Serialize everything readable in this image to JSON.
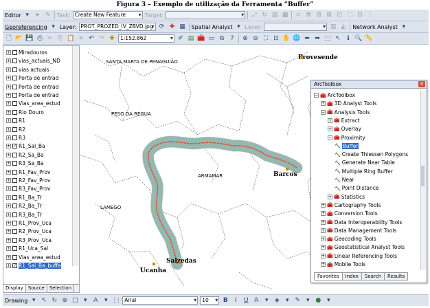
{
  "caption": "Figura 3 – Exemplo de utilização da Ferramenta “Buffer”",
  "toolbar1": {
    "editor_label": "Editor",
    "task_label": "Task:",
    "task_value": "Create New Feature",
    "target_label": "Target:",
    "target_value": ""
  },
  "toolbar2": {
    "georef_label": "Georeferencing",
    "layer_label": "Layer:",
    "layer_value": "PROT_PROZED_IV_ZBVD.jpg",
    "spatial_label": "Spatial Analyst",
    "layer2_label": "Layer:",
    "layer2_value": "",
    "network_label": "Network Analyst"
  },
  "toolbar3": {
    "scale_value": "1:152.862"
  },
  "layers": [
    {
      "name": "Miradouros",
      "checked": false
    },
    {
      "name": "vias_actuais_ND",
      "checked": false
    },
    {
      "name": "vias actuais",
      "checked": false
    },
    {
      "name": "Porta de entrad",
      "checked": false
    },
    {
      "name": "Porta de entrad",
      "checked": false
    },
    {
      "name": "Porta de entrad",
      "checked": false
    },
    {
      "name": "Vias_area_estud",
      "checked": false
    },
    {
      "name": "Rio Douro",
      "checked": false
    },
    {
      "name": "R1",
      "checked": false
    },
    {
      "name": "R2",
      "checked": false
    },
    {
      "name": "R3",
      "checked": false
    },
    {
      "name": "R1_Sal_Ba",
      "checked": true
    },
    {
      "name": "R2_Sa_Ba",
      "checked": false
    },
    {
      "name": "R3_Sa_Ba",
      "checked": false
    },
    {
      "name": "R1_Fav_Prov",
      "checked": false
    },
    {
      "name": "R2_Fav_Prov",
      "checked": false
    },
    {
      "name": "R3_Fav_Prov",
      "checked": false
    },
    {
      "name": "R1_Ba_Tr",
      "checked": false
    },
    {
      "name": "R2_Ba_Tr",
      "checked": false
    },
    {
      "name": "R3_Ba_Tr",
      "checked": false
    },
    {
      "name": "R1_Prov_Uca",
      "checked": false
    },
    {
      "name": "R2_Prov_Uca",
      "checked": false
    },
    {
      "name": "R3_Prov_Uca",
      "checked": false
    },
    {
      "name": "R1_Uca_Sal",
      "checked": false
    },
    {
      "name": "Vias_area_estud",
      "checked": false
    },
    {
      "name": "R1_Sal_Ba_buffe",
      "checked": true,
      "selected": true
    }
  ],
  "sidebar_tabs": [
    "Display",
    "Source",
    "Selection"
  ],
  "map": {
    "places": [
      {
        "name": "SANTA MARTA DE PENAGUIÃO",
        "style": "small"
      },
      {
        "name": "PESO DA RÉGUA",
        "style": "small"
      },
      {
        "name": "ARMAMAR",
        "style": "small"
      },
      {
        "name": "LAMEGO",
        "style": "small"
      },
      {
        "name": "Provesende",
        "style": "big"
      },
      {
        "name": "Barcos",
        "style": "big"
      },
      {
        "name": "Salzedas",
        "style": "big"
      },
      {
        "name": "Ucanha",
        "style": "big"
      }
    ],
    "buffer_color": "#b8e6dc",
    "route_color": "#e04a2f"
  },
  "arctoolbox": {
    "title": "ArcToolbox",
    "items": [
      {
        "label": "ArcToolbox",
        "level": 0,
        "type": "root"
      },
      {
        "label": "3D Analyst Tools",
        "level": 1,
        "type": "box"
      },
      {
        "label": "Analysis Tools",
        "level": 1,
        "type": "box"
      },
      {
        "label": "Extract",
        "level": 2,
        "type": "set"
      },
      {
        "label": "Overlay",
        "level": 2,
        "type": "set"
      },
      {
        "label": "Proximity",
        "level": 2,
        "type": "set"
      },
      {
        "label": "Buffer",
        "level": 3,
        "type": "tool",
        "highlight": true
      },
      {
        "label": "Create Thiessen Polygons",
        "level": 3,
        "type": "tool"
      },
      {
        "label": "Generate Near Table",
        "level": 3,
        "type": "tool"
      },
      {
        "label": "Multiple Ring Buffer",
        "level": 3,
        "type": "tool"
      },
      {
        "label": "Near",
        "level": 3,
        "type": "tool"
      },
      {
        "label": "Point Distance",
        "level": 3,
        "type": "tool"
      },
      {
        "label": "Statistics",
        "level": 2,
        "type": "set"
      },
      {
        "label": "Cartography Tools",
        "level": 1,
        "type": "box"
      },
      {
        "label": "Conversion Tools",
        "level": 1,
        "type": "box"
      },
      {
        "label": "Data Interoperability Tools",
        "level": 1,
        "type": "box"
      },
      {
        "label": "Data Management Tools",
        "level": 1,
        "type": "box"
      },
      {
        "label": "Geocoding Tools",
        "level": 1,
        "type": "box"
      },
      {
        "label": "Geostatistical Analyst Tools",
        "level": 1,
        "type": "box"
      },
      {
        "label": "Linear Referencing Tools",
        "level": 1,
        "type": "box"
      },
      {
        "label": "Mobile Tools",
        "level": 1,
        "type": "box"
      }
    ],
    "tabs": [
      "Favorites",
      "Index",
      "Search",
      "Results"
    ]
  },
  "drawing": {
    "drawing_label": "Drawing",
    "font_value": "Arial",
    "size_value": "10",
    "bold": "B",
    "italic": "I",
    "underline": "U"
  }
}
